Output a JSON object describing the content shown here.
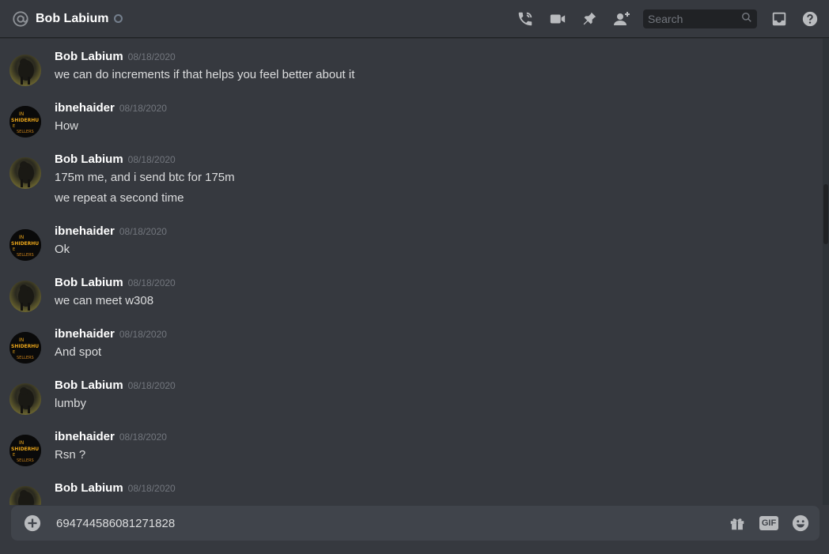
{
  "header": {
    "channel_name": "Bob Labium",
    "search_placeholder": "Search",
    "icons": [
      "at-icon",
      "call-icon",
      "video-icon",
      "pin-icon",
      "add-friend-icon",
      "search-icon",
      "inbox-icon",
      "help-icon"
    ]
  },
  "messages": [
    {
      "author": "Bob Labium",
      "timestamp": "08/18/2020",
      "lines": [
        "we can do increments if that helps you feel better about it"
      ]
    },
    {
      "author": "ibnehaider",
      "timestamp": "08/18/2020",
      "lines": [
        "How"
      ]
    },
    {
      "author": "Bob Labium",
      "timestamp": "08/18/2020",
      "lines": [
        "175m me, and i send btc for 175m",
        "we repeat a second time"
      ]
    },
    {
      "author": "ibnehaider",
      "timestamp": "08/18/2020",
      "lines": [
        "Ok"
      ]
    },
    {
      "author": "Bob Labium",
      "timestamp": "08/18/2020",
      "lines": [
        "we can meet w308"
      ]
    },
    {
      "author": "ibnehaider",
      "timestamp": "08/18/2020",
      "lines": [
        "And spot"
      ]
    },
    {
      "author": "Bob Labium",
      "timestamp": "08/18/2020",
      "lines": [
        "lumby"
      ]
    },
    {
      "author": "ibnehaider",
      "timestamp": "08/18/2020",
      "lines": [
        "Rsn ?"
      ]
    },
    {
      "author": "Bob Labium",
      "timestamp": "08/18/2020",
      "lines": []
    }
  ],
  "composer": {
    "value": "694744586081271828",
    "gif_label": "GIF"
  },
  "avatars": {
    "ibnehaider_text": [
      "IN",
      "SHIDERHU",
      "E",
      "SELLERS"
    ]
  },
  "colors": {
    "background": "#36393f",
    "composer_bg": "#40444b",
    "username": "#ffffff",
    "timestamp": "#72767d",
    "text": "#dcddde",
    "icon": "#b9bbbe"
  }
}
